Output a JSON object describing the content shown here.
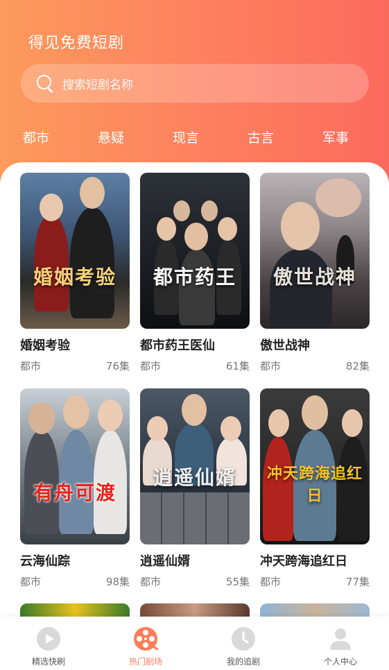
{
  "header": {
    "app_title": "得见免费短剧",
    "search_placeholder": "搜索短剧名称"
  },
  "categories": [
    "都市",
    "悬疑",
    "现言",
    "古言",
    "军事"
  ],
  "dramas": [
    {
      "name": "婚姻考验",
      "genre": "都市",
      "episodes": "76集",
      "poster_text": "婚姻考验",
      "poster_color": "#f4d27a"
    },
    {
      "name": "都市药王医仙",
      "genre": "都市",
      "episodes": "61集",
      "poster_text": "都市药王",
      "poster_color": "#ffffff"
    },
    {
      "name": "傲世战神",
      "genre": "都市",
      "episodes": "82集",
      "poster_text": "傲世战神",
      "poster_color": "#e8e2dc"
    },
    {
      "name": "云海仙踪",
      "genre": "都市",
      "episodes": "98集",
      "poster_text": "有舟可渡",
      "poster_color": "#e8221b"
    },
    {
      "name": "逍遥仙婿",
      "genre": "都市",
      "episodes": "55集",
      "poster_text": "逍遥仙婿",
      "poster_color": "#f0f0f0"
    },
    {
      "name": "冲天跨海追红日",
      "genre": "都市",
      "episodes": "77集",
      "poster_text": "冲天跨海追红日",
      "poster_color": "#f7c325"
    }
  ],
  "tabs": [
    {
      "label": "精选快刷",
      "icon": "play-icon",
      "active": false
    },
    {
      "label": "热门剧场",
      "icon": "film-reel-icon",
      "active": true
    },
    {
      "label": "我的追剧",
      "icon": "clock-icon",
      "active": false
    },
    {
      "label": "个人中心",
      "icon": "person-icon",
      "active": false
    }
  ],
  "colors": {
    "header_gradient_start": "#fd9a5c",
    "header_gradient_end": "#fc6a5d",
    "accent": "#fb7d5b"
  }
}
